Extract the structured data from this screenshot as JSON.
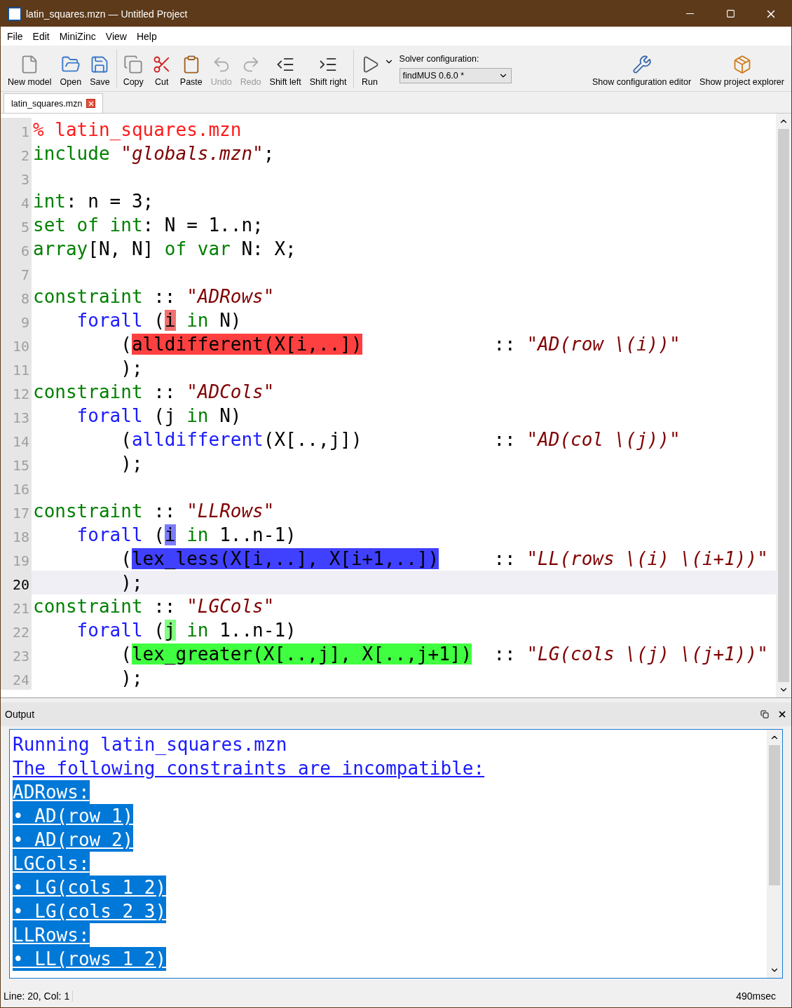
{
  "window": {
    "title": "latin_squares.mzn — Untitled Project"
  },
  "menu": [
    "File",
    "Edit",
    "MiniZinc",
    "View",
    "Help"
  ],
  "toolbar": [
    {
      "label": "New model",
      "kind": "new",
      "disabled": false
    },
    {
      "label": "Open",
      "kind": "open",
      "disabled": false
    },
    {
      "label": "Save",
      "kind": "save",
      "disabled": false
    },
    {
      "label": "Copy",
      "kind": "copy",
      "disabled": false
    },
    {
      "label": "Cut",
      "kind": "cut",
      "disabled": false
    },
    {
      "label": "Paste",
      "kind": "paste",
      "disabled": false
    },
    {
      "label": "Undo",
      "kind": "undo",
      "disabled": true
    },
    {
      "label": "Redo",
      "kind": "redo",
      "disabled": true
    },
    {
      "label": "Shift left",
      "kind": "shiftleft",
      "disabled": false
    },
    {
      "label": "Shift right",
      "kind": "shiftright",
      "disabled": false
    },
    {
      "label": "Run",
      "kind": "run",
      "disabled": false
    }
  ],
  "solver": {
    "label": "Solver configuration:",
    "value": "findMUS 0.6.0 *"
  },
  "toolbar_right": [
    {
      "label": "Show configuration editor",
      "kind": "config"
    },
    {
      "label": "Show project explorer",
      "kind": "project"
    }
  ],
  "tabs": [
    {
      "label": "latin_squares.mzn",
      "selected": true
    }
  ],
  "editor": {
    "lines": [
      {
        "number": "1",
        "selected": false,
        "tokens": [
          {
            "text": "% latin_squares.mzn",
            "kind": "comment"
          }
        ]
      },
      {
        "number": "2",
        "selected": false,
        "tokens": [
          {
            "text": "include ",
            "kind": "keyword"
          },
          {
            "text": "\"globals.mzn\"",
            "kind": "string"
          },
          {
            "text": ";",
            "kind": "plain"
          }
        ]
      },
      {
        "number": "3",
        "selected": false
      },
      {
        "number": "4",
        "selected": false,
        "tokens": [
          {
            "text": "int",
            "kind": "keyword"
          },
          {
            "text": ": n = 3;",
            "kind": "plain"
          }
        ]
      },
      {
        "number": "5",
        "selected": false,
        "tokens": [
          {
            "text": "set of int",
            "kind": "keyword"
          },
          {
            "text": ": N = 1..n;",
            "kind": "plain"
          }
        ]
      },
      {
        "number": "6",
        "selected": false,
        "tokens": [
          {
            "text": "array",
            "kind": "keyword"
          },
          {
            "text": "[N, N] ",
            "kind": "plain"
          },
          {
            "text": "of var",
            "kind": "keyword"
          },
          {
            "text": " N: X;",
            "kind": "plain"
          }
        ]
      },
      {
        "number": "7",
        "selected": false
      },
      {
        "number": "8",
        "selected": false,
        "tokens": [
          {
            "text": "constraint",
            "kind": "keyword"
          },
          {
            "text": " :: ",
            "kind": "plain"
          },
          {
            "text": "\"ADRows\"",
            "kind": "string"
          }
        ]
      },
      {
        "number": "9",
        "selected": false,
        "tokens": [
          {
            "text": "    forall",
            "kind": "builtin"
          },
          {
            "text": " (",
            "kind": "plain"
          },
          {
            "text": "i",
            "kind": "plain",
            "color": "#f07070"
          },
          {
            "text": " in",
            "kind": "keyword"
          },
          {
            "text": " N)",
            "kind": "plain"
          }
        ]
      },
      {
        "number": "10",
        "selected": false,
        "tokens": [
          {
            "text": "        (",
            "kind": "plain"
          },
          {
            "text": "alldifferent(X[i,..])",
            "kind": "plain",
            "color": "#ff4040"
          },
          {
            "text": "            :: ",
            "kind": "plain"
          },
          {
            "text": "\"AD(row \\(i))\"",
            "kind": "string"
          }
        ]
      },
      {
        "number": "11",
        "selected": false,
        "tokens": [
          {
            "text": "        );",
            "kind": "plain"
          }
        ]
      },
      {
        "number": "12",
        "selected": false,
        "tokens": [
          {
            "text": "constraint",
            "kind": "keyword"
          },
          {
            "text": " :: ",
            "kind": "plain"
          },
          {
            "text": "\"ADCols\"",
            "kind": "string"
          }
        ]
      },
      {
        "number": "13",
        "selected": false,
        "tokens": [
          {
            "text": "    forall",
            "kind": "builtin"
          },
          {
            "text": " (j ",
            "kind": "plain"
          },
          {
            "text": "in",
            "kind": "keyword"
          },
          {
            "text": " N)",
            "kind": "plain"
          }
        ]
      },
      {
        "number": "14",
        "selected": false,
        "tokens": [
          {
            "text": "        (",
            "kind": "plain"
          },
          {
            "text": "alldifferent",
            "kind": "builtin"
          },
          {
            "text": "(X[..,j])            :: ",
            "kind": "plain"
          },
          {
            "text": "\"AD(col \\(j))\"",
            "kind": "string"
          }
        ]
      },
      {
        "number": "15",
        "selected": false,
        "tokens": [
          {
            "text": "        );",
            "kind": "plain"
          }
        ]
      },
      {
        "number": "16",
        "selected": false
      },
      {
        "number": "17",
        "selected": false,
        "tokens": [
          {
            "text": "constraint",
            "kind": "keyword"
          },
          {
            "text": " :: ",
            "kind": "plain"
          },
          {
            "text": "\"LLRows\"",
            "kind": "string"
          }
        ]
      },
      {
        "number": "18",
        "selected": false,
        "tokens": [
          {
            "text": "    forall",
            "kind": "builtin"
          },
          {
            "text": " (",
            "kind": "plain"
          },
          {
            "text": "i",
            "kind": "plain",
            "color": "#7b7bff"
          },
          {
            "text": " in",
            "kind": "keyword"
          },
          {
            "text": " 1..n-1)",
            "kind": "plain"
          }
        ]
      },
      {
        "number": "19",
        "selected": false,
        "tokens": [
          {
            "text": "        (",
            "kind": "plain"
          },
          {
            "text": "lex_less(X[i,..], X[i+1,..])",
            "kind": "plain",
            "color": "#4040ff"
          },
          {
            "text": "     :: ",
            "kind": "plain"
          },
          {
            "text": "\"LL(rows \\(i) \\(i+1))\"",
            "kind": "string"
          }
        ]
      },
      {
        "number": "20",
        "selected": true,
        "tokens": [
          {
            "text": "        );",
            "kind": "plain"
          }
        ]
      },
      {
        "number": "21",
        "selected": false,
        "tokens": [
          {
            "text": "constraint",
            "kind": "keyword"
          },
          {
            "text": " :: ",
            "kind": "plain"
          },
          {
            "text": "\"LGCols\"",
            "kind": "string"
          }
        ]
      },
      {
        "number": "22",
        "selected": false,
        "tokens": [
          {
            "text": "    forall",
            "kind": "builtin"
          },
          {
            "text": " (",
            "kind": "plain"
          },
          {
            "text": "j",
            "kind": "plain",
            "color": "#80ff80"
          },
          {
            "text": " in",
            "kind": "keyword"
          },
          {
            "text": " 1..n-1)",
            "kind": "plain"
          }
        ]
      },
      {
        "number": "23",
        "selected": false,
        "tokens": [
          {
            "text": "        (",
            "kind": "plain"
          },
          {
            "text": "lex_greater(X[..,j], X[..,j+1])",
            "kind": "plain",
            "color": "#40ff40"
          },
          {
            "text": "  :: ",
            "kind": "plain"
          },
          {
            "text": "\"LG(cols \\(j) \\(j+1))\"",
            "kind": "string"
          }
        ]
      },
      {
        "number": "24",
        "selected": false,
        "tokens": [
          {
            "text": "        );",
            "kind": "plain"
          }
        ]
      }
    ]
  },
  "output": {
    "title": "Output",
    "lines": [
      {
        "text": "Running latin_squares.mzn",
        "kind": "message"
      },
      {
        "text": "The following constraints are incompatible:",
        "kind": "link"
      },
      {
        "text": "ADRows:",
        "kind": "marked"
      },
      {
        "text": "• AD(row 1)",
        "kind": "marked"
      },
      {
        "text": "• AD(row 2)",
        "kind": "marked"
      },
      {
        "text": "LGCols:",
        "kind": "marked"
      },
      {
        "text": "• LG(cols 1 2)",
        "kind": "marked"
      },
      {
        "text": "• LG(cols 2 3)",
        "kind": "marked"
      },
      {
        "text": "LLRows:",
        "kind": "marked"
      },
      {
        "text": "• LL(rows 1 2)",
        "kind": "marked"
      }
    ]
  },
  "status_bar": {
    "position": "Line: 20, Col: 1",
    "time": "490msec"
  }
}
